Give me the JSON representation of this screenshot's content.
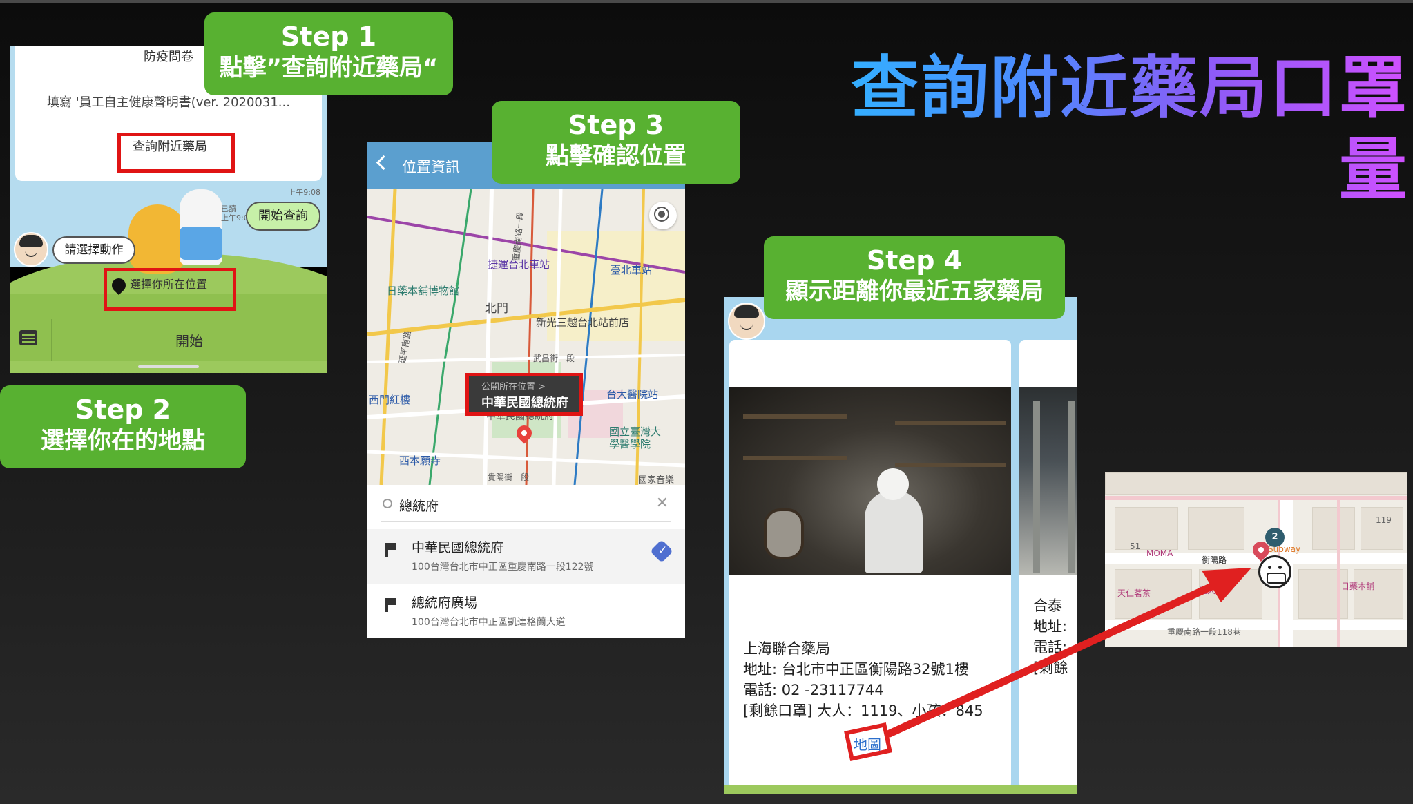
{
  "title": "查詢附近藥局口罩量",
  "steps": [
    {
      "line1": "Step 1",
      "line2": "點擊”查詢附近藥局“"
    },
    {
      "line1": "Step 2",
      "line2": "選擇你在的地點"
    },
    {
      "line1": "Step 3",
      "line2": "點擊確認位置"
    },
    {
      "line1": "Step 4",
      "line2": "顯示距離你最近五家藥局"
    }
  ],
  "phone1": {
    "survey": "防疫問卷",
    "fill_form": "填寫 '員工自主健康聲明書(ver. 2020031...",
    "nearby_btn": "查詢附近藥局",
    "time1": "上午9:08",
    "read": "已讀",
    "time2": "上午9:08",
    "bubble_right": "開始查詢",
    "bubble_left": "請選擇動作",
    "choose_location": "選擇你所在位置",
    "start": "開始"
  },
  "phone2": {
    "header": "位置資訊",
    "map_labels": {
      "mrt": "捷運台北車站",
      "taipei_station": "臺北車站",
      "museum": "日藥本舖博物館",
      "beimen": "北門",
      "mitsukoshi": "新光三越台北站前店",
      "ximen": "西門紅樓",
      "ntuh": "台大醫院站",
      "ntu_med": "國立臺灣大學醫學院",
      "xiben": "西本願寺",
      "guigang": "貴陽街一段",
      "wuchang": "武昌街一段",
      "yanping": "延平南路",
      "chongqing": "重慶南路一段",
      "zhongzheng": "中華民國總統府",
      "music": "國家音樂"
    },
    "tooltip_small": "公開所在位置 >",
    "tooltip_main": "中華民國總統府",
    "search_text": "總統府",
    "results": [
      {
        "name": "中華民國總統府",
        "addr": "100台灣台北市中正區重慶南路一段122號",
        "selected": true
      },
      {
        "name": "總統府廣場",
        "addr": "100台灣台北市中正區凱達格蘭大道",
        "selected": false
      }
    ]
  },
  "phone3": {
    "card1": {
      "name": "上海聯合藥局",
      "address": "地址: 台北市中正區衡陽路32號1樓",
      "phone": "電話: 02 -23117744",
      "stock": "[剩餘口罩] 大人：1119、小孩：845",
      "map_link": "地圖"
    },
    "card2": {
      "name": "合泰",
      "address": "地址:",
      "phone": "電話:",
      "stock": "[剩餘"
    }
  },
  "minimap": {
    "labels": {
      "moma": "MOMA",
      "hengyang": "衡陽路",
      "subway": "Subway",
      "chongqing": "重慶南路一段118巷",
      "japan": "日藥本舖",
      "yuanda": "元大",
      "tianren": "天仁茗茶",
      "n119": "119",
      "n51": "51"
    },
    "badge": "2"
  }
}
